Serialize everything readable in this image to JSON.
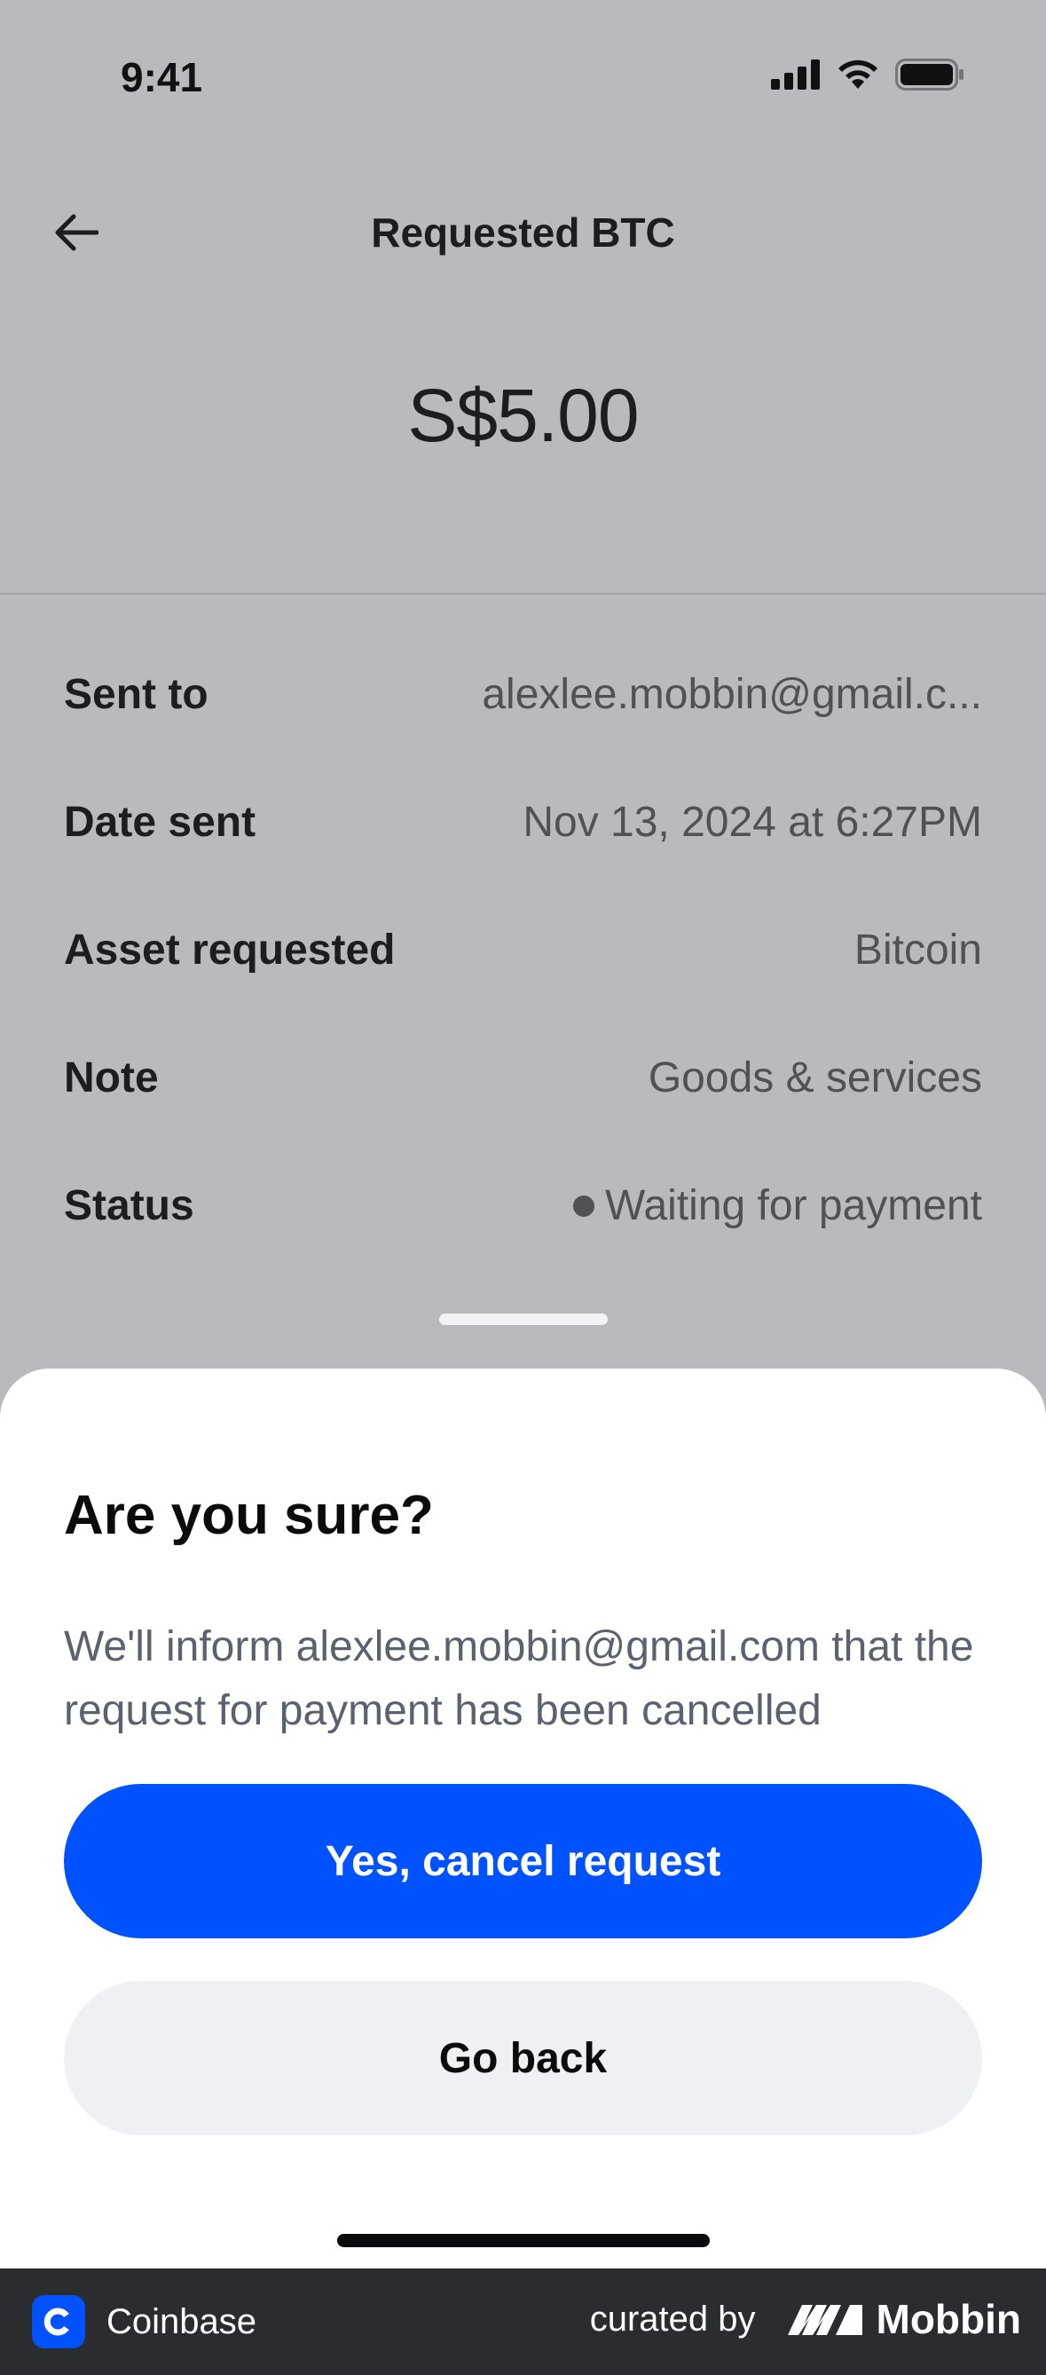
{
  "status_bar": {
    "time": "9:41"
  },
  "header": {
    "title": "Requested BTC"
  },
  "amount": "S$5.00",
  "details": [
    {
      "label": "Sent to",
      "value": "alexlee.mobbin@gmail.c..."
    },
    {
      "label": "Date sent",
      "value": "Nov 13, 2024 at 6:27PM"
    },
    {
      "label": "Asset requested",
      "value": "Bitcoin"
    },
    {
      "label": "Note",
      "value": "Goods & services"
    },
    {
      "label": "Status",
      "value": "Waiting for payment"
    }
  ],
  "sheet": {
    "title": "Are you sure?",
    "body": "We'll inform alexlee.mobbin@gmail.com that the request for payment has been cancelled",
    "confirm_label": "Yes, cancel request",
    "back_label": "Go back"
  },
  "footer": {
    "app_name": "Coinbase",
    "curated_by": "curated by",
    "brand": "Mobbin"
  },
  "colors": {
    "primary": "#0052ff",
    "overlay_bg": "#b9babe",
    "secondary_button": "#eef0f3"
  },
  "icons": [
    "signal-icon",
    "wifi-icon",
    "battery-icon",
    "back-arrow-icon",
    "coinbase-logo-icon",
    "mobbin-logo-icon"
  ]
}
